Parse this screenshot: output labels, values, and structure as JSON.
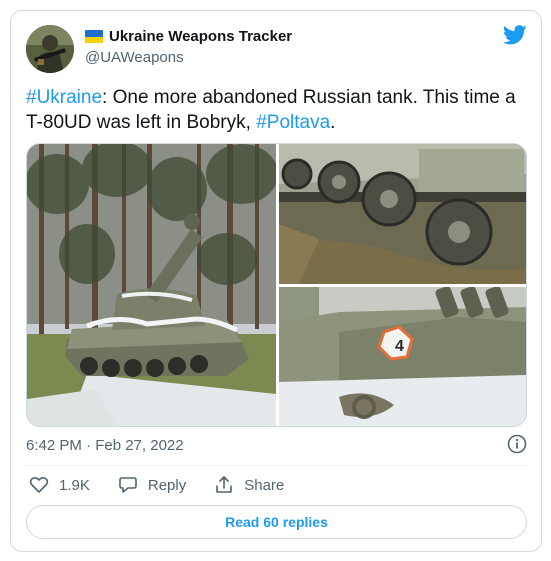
{
  "account": {
    "display_name": "Ukraine Weapons Tracker",
    "handle": "@UAWeapons",
    "avatar_icon": "soldier-avatar",
    "flag_colors": [
      "#1f6fd0",
      "#f5d000"
    ]
  },
  "tweet": {
    "hashtag1": "#Ukraine",
    "text1": ": One more abandoned Russian tank. This time a T-80UD was left in Bobryk, ",
    "hashtag2": "#Poltava",
    "text2": ".",
    "timestamp": "6:42 PM · Feb 27, 2022"
  },
  "media": {
    "turret_number": "4"
  },
  "actions": {
    "like_count": "1.9K",
    "reply_label": "Reply",
    "share_label": "Share"
  },
  "read_replies_label": "Read 60 replies",
  "colors": {
    "accent": "#1d9bf0",
    "text": "#0f1419",
    "muted": "#536471",
    "border": "#cfd9de"
  }
}
